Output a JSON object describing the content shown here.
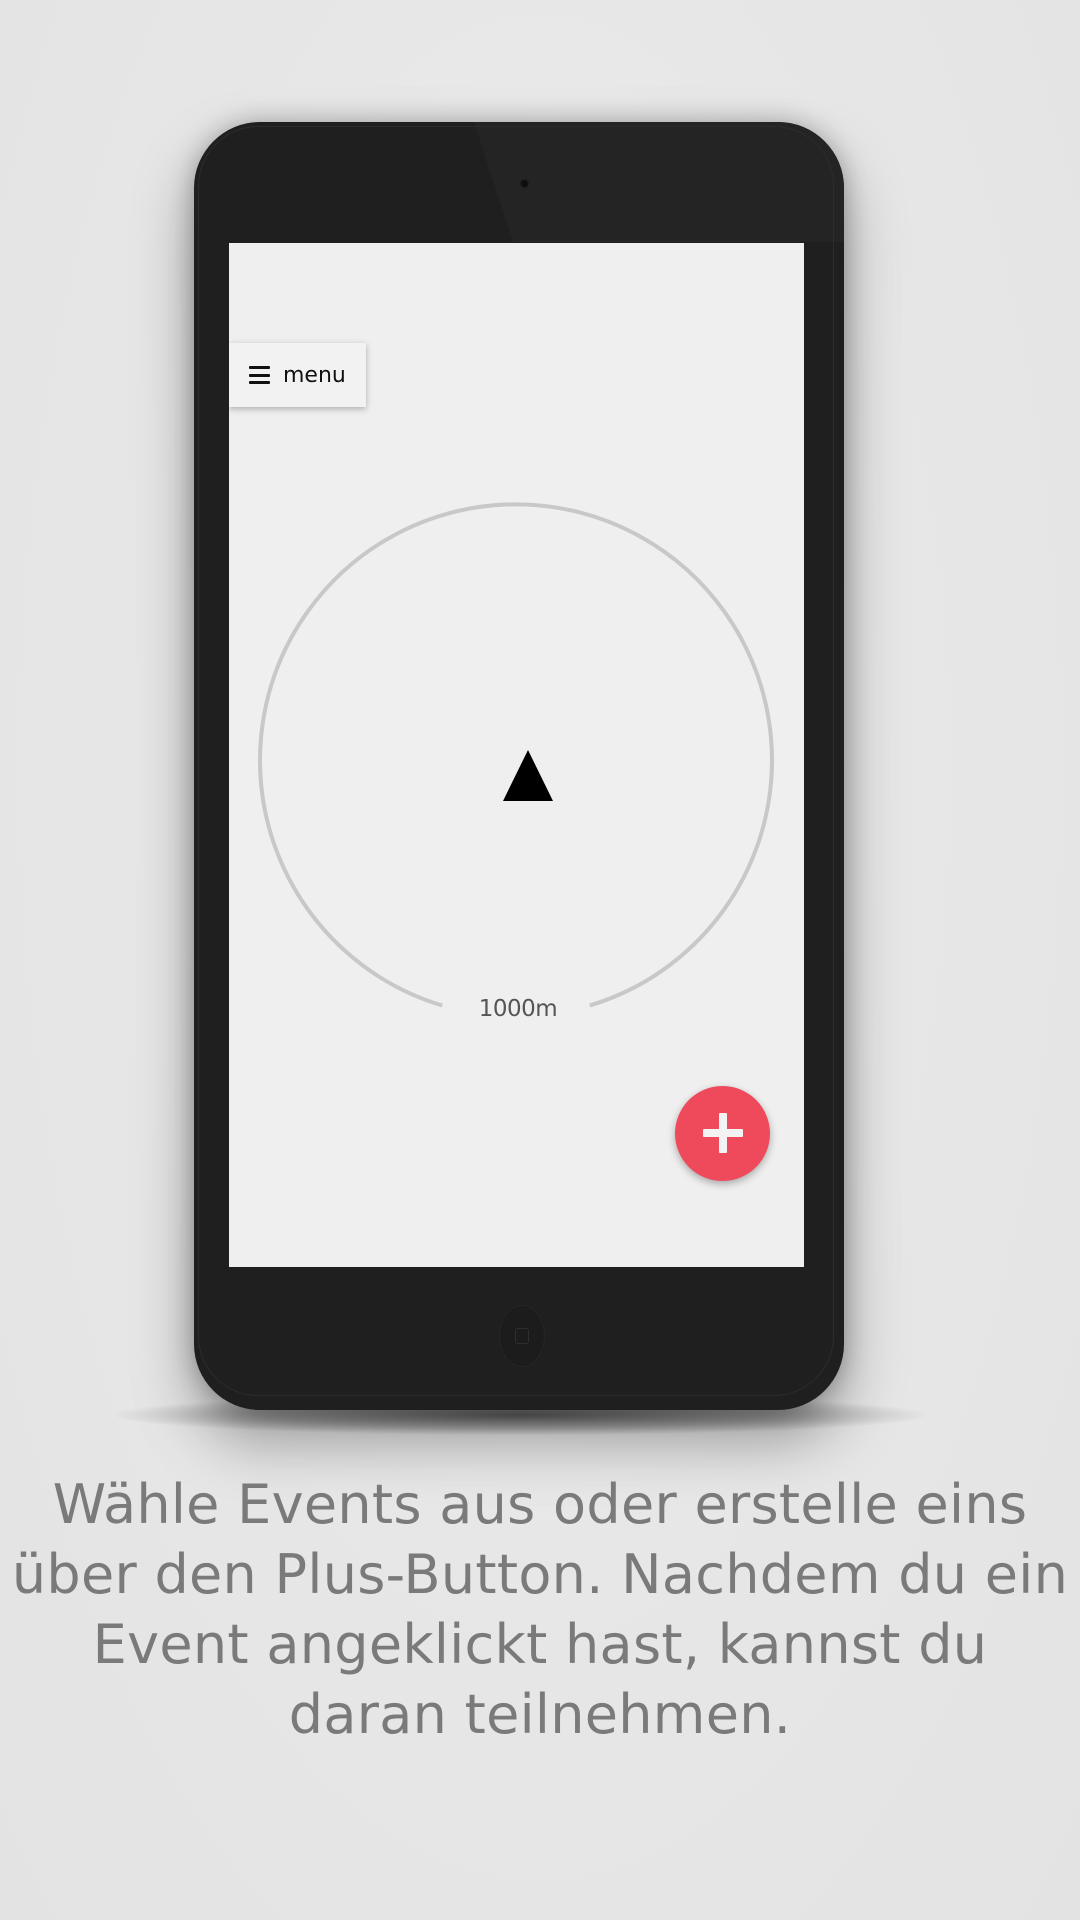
{
  "app": {
    "menu_label": "menu",
    "menu_icon": "hamburger-icon",
    "radius_label": "1000m",
    "position_icon": "triangle-up-icon",
    "fab_icon": "plus-icon",
    "colors": {
      "fab": "#ef4a5c",
      "screen_bg": "#efefef",
      "radar_ring": "#c8c8c8"
    }
  },
  "caption": {
    "line1": "Wähle Events aus oder erstelle eins",
    "line2": "über den Plus-Button. Nachdem du ein",
    "line3": "Event angeklickt hast, kannst du",
    "line4": "daran teilnehmen."
  }
}
